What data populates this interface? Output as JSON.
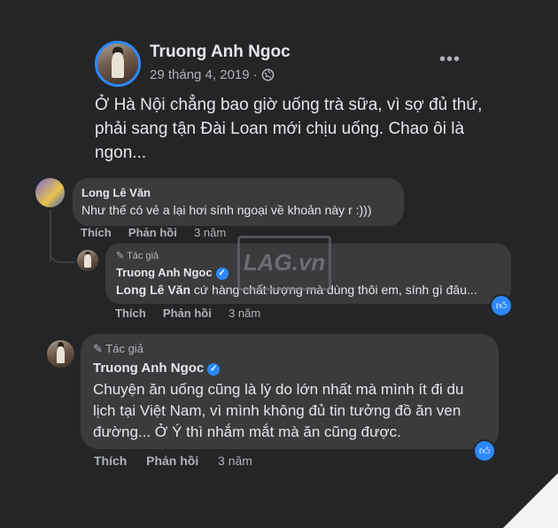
{
  "post": {
    "author": "Truong Anh Ngoc",
    "date": "29 tháng 4, 2019 ·",
    "privacy_icon": "globe-icon",
    "text": "Ở Hà Nội chẳng bao giờ uống trà sữa, vì sợ đủ thứ, phải sang tận Đài Loan mới chịu uống. Chao ôi là ngon..."
  },
  "comments": [
    {
      "author": "Long Lê Văn",
      "text": "Như thế có vẻ a lại hơi sính ngoại về khoản này r :)))",
      "like_label": "Thích",
      "reply_label": "Phản hồi",
      "time": "3 năm",
      "replies": [
        {
          "badge": "Tác giả",
          "author": "Truong Anh Ngoc",
          "mention": "Long Lê Văn",
          "text": " cứ hàng chất lượng mà dùng thôi em, sính gì đâu...",
          "like_label": "Thích",
          "reply_label": "Phản hồi",
          "time": "3 năm"
        }
      ]
    },
    {
      "badge": "Tác giả",
      "author": "Truong Anh Ngoc",
      "text": "Chuyện ăn uống cũng là lý do lớn nhất mà mình ít đi du lịch tại Việt Nam, vì mình không đủ tin tưởng đồ ăn ven đường... Ở Ý thì nhắm mắt mà ăn cũng được.",
      "like_label": "Thích",
      "reply_label": "Phản hồi",
      "time": "3 năm"
    }
  ],
  "watermark": "LAG.vn",
  "colors": {
    "background": "#242526",
    "bubble": "#3a3b3c",
    "accent": "#2d88ff"
  }
}
